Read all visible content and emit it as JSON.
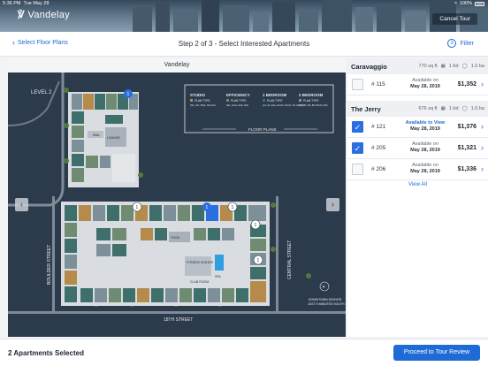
{
  "status_bar": {
    "time": "5:36 PM",
    "date": "Tue May 28",
    "battery": "100%"
  },
  "header": {
    "brand": "Vandelay",
    "cancel_label": "Cancel Tour"
  },
  "subheader": {
    "back_label": "Select Floor Plans",
    "step_title": "Step 2 of 3 - Select Interested Apartments",
    "filter_label": "Filter"
  },
  "map": {
    "title": "Vandelay",
    "level_label": "LEVEL 2",
    "floor_plans_label": "FLOOR PLANS",
    "legend": [
      {
        "name": "STUDIO",
        "type": "PLAN TYPE",
        "codes": "(S1, S2, S3A, S2.HC)"
      },
      {
        "name": "EFFICIENCY",
        "type": "PLAN TYPE",
        "codes": "(E1, E1a, E1b, E2)"
      },
      {
        "name": "1 BEDROOM",
        "type": "PLAN TYPE",
        "codes": "(A1, A2, A3a, A2.HC, A3.HC, A5, A6, A7)"
      },
      {
        "name": "2 BEDROOM",
        "type": "PLAN TYPE",
        "codes": "(B1, B2, B3, B4, B4.HC, B5)"
      }
    ],
    "streets": {
      "west": "BOULDER STREET",
      "east": "CENTRAL STREET",
      "south": "18TH STREET"
    },
    "amenities": [
      "LOUNGE",
      "MAIL",
      "YOGA",
      "FITNESS CENTER",
      "CLUB ROOM",
      "SPA"
    ],
    "note": "DOWNTOWN DENVER JUST 5 MINUTES SOUTH",
    "markers": [
      "1",
      "1",
      "1",
      "1",
      "1",
      "1"
    ],
    "colors": {
      "studio": "#b58a4a",
      "efficiency": "#6f8c73",
      "one_bed": "#3f6f6a",
      "two_bed": "#7d8f98",
      "selected": "#2a6ee0"
    }
  },
  "buildings": [
    {
      "name": "Caravaggio",
      "sqft": "770 sq ft",
      "beds": "1 bd",
      "baths": "1.0 ba",
      "units": [
        {
          "unit": "# 115",
          "avail_label": "Available on",
          "date": "May 28, 2019",
          "price": "$1,352",
          "selected": false
        }
      ]
    },
    {
      "name": "The Jerry",
      "sqft": "676 sq ft",
      "beds": "1 bd",
      "baths": "1.0 ba",
      "units": [
        {
          "unit": "# 121",
          "avail_label": "Available to View",
          "date": "May 28, 2019",
          "price": "$1,376",
          "selected": true
        },
        {
          "unit": "# 205",
          "avail_label": "Available on",
          "date": "May 28, 2019",
          "price": "$1,321",
          "selected": true
        },
        {
          "unit": "# 206",
          "avail_label": "Available on",
          "date": "May 28, 2019",
          "price": "$1,336",
          "selected": false
        }
      ]
    }
  ],
  "view_all_label": "View All",
  "footer": {
    "selected_text": "2 Apartments Selected",
    "proceed_label": "Proceed to Tour Review"
  }
}
